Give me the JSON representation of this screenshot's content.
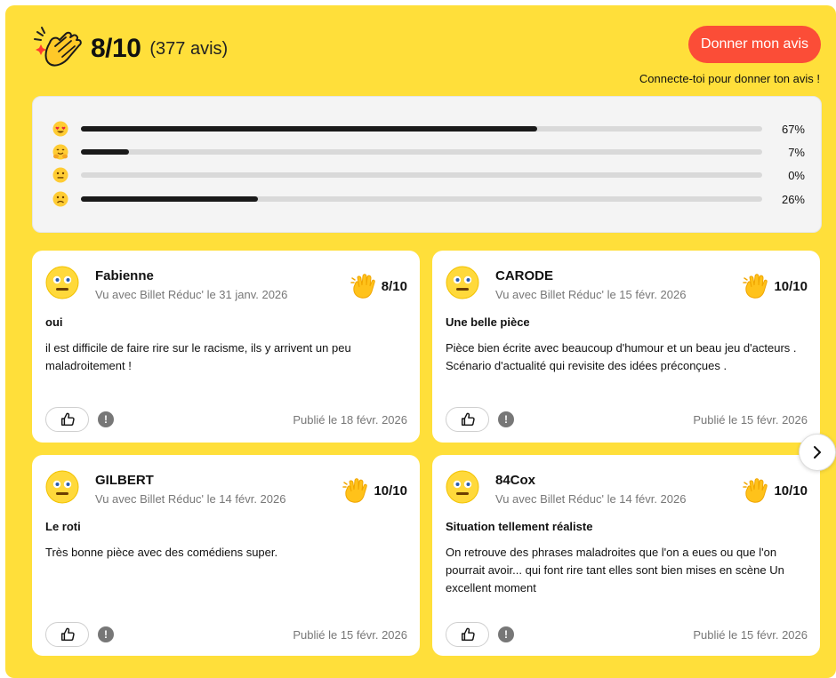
{
  "header": {
    "score": "8/10",
    "count": "(377 avis)",
    "give_review_label": "Donner mon avis",
    "login_hint": "Connecte-toi pour donner ton avis !",
    "icon": "clapping-hands-icon"
  },
  "colors": {
    "panel": "#ffdf3a",
    "button": "#fb4d37",
    "bar_fill": "#1a1a1a",
    "bar_track": "#d9d9d9"
  },
  "distribution": [
    {
      "icon": "heart-eyes-face-icon",
      "percent": 67,
      "label": "67%"
    },
    {
      "icon": "hugging-face-icon",
      "percent": 7,
      "label": "7%"
    },
    {
      "icon": "neutral-face-icon",
      "percent": 0,
      "label": "0%"
    },
    {
      "icon": "sad-face-icon",
      "percent": 26,
      "label": "26%"
    }
  ],
  "reviews": [
    {
      "author": "Fabienne",
      "meta": "Vu avec Billet Réduc' le 31 janv. 2026",
      "rating": "8/10",
      "title": "oui",
      "body": "il est difficile de faire rire sur le racisme, ils y arrivent un peu maladroitement !",
      "published": "Publié le 18 févr. 2026"
    },
    {
      "author": "CARODE",
      "meta": "Vu avec Billet Réduc' le 15 févr. 2026",
      "rating": "10/10",
      "title": "Une belle pièce",
      "body": "Pièce bien écrite avec beaucoup d'humour et un beau jeu d'acteurs . Scénario d'actualité qui revisite des idées préconçues .",
      "published": "Publié le 15 févr. 2026"
    },
    {
      "author": "GILBERT",
      "meta": "Vu avec Billet Réduc' le 14 févr. 2026",
      "rating": "10/10",
      "title": "Le roti",
      "body": "Très bonne pièce avec des comédiens super.",
      "published": "Publié le 15 févr. 2026"
    },
    {
      "author": "84Cox",
      "meta": "Vu avec Billet Réduc' le 14 févr. 2026",
      "rating": "10/10",
      "title": "Situation tellement réaliste",
      "body": "On retrouve des phrases maladroites que l'on a eues ou que l'on pourrait avoir... qui font rire tant elles sont bien mises en scène Un excellent moment",
      "published": "Publié le 15 févr. 2026"
    }
  ],
  "report_glyph": "!"
}
